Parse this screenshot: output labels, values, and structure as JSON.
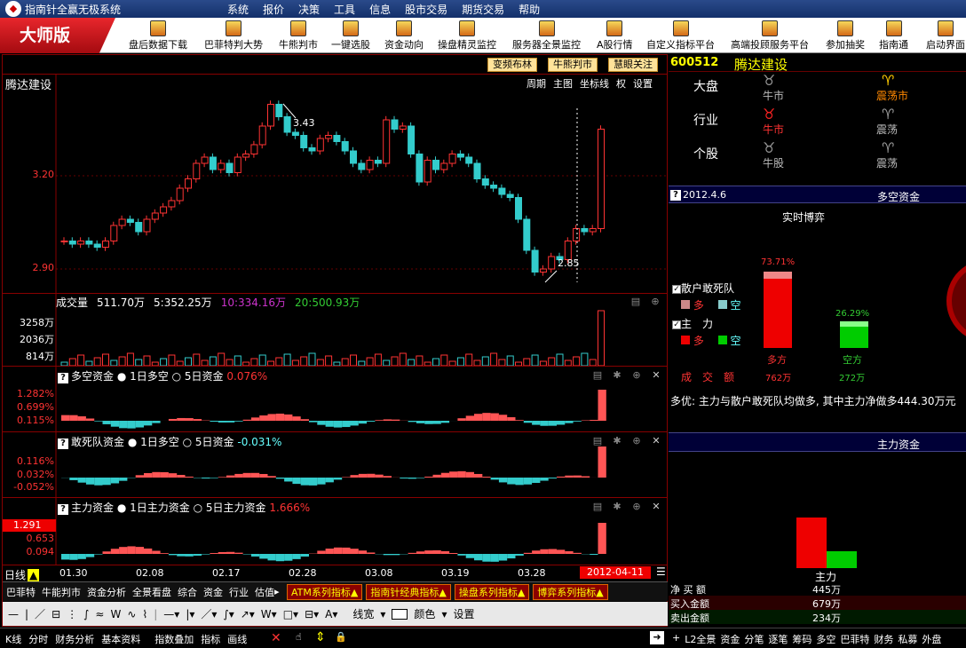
{
  "title_bar": {
    "app_title": "指南针全赢无极系统",
    "menu": [
      "系统",
      "报价",
      "决策",
      "工具",
      "信息",
      "股市交易",
      "期货交易",
      "帮助"
    ]
  },
  "toolbar": {
    "edition": "大师版",
    "buttons": [
      "盘后数据下载",
      "巴菲特判大势",
      "牛熊判市",
      "一键选股",
      "资金动向",
      "操盘精灵监控",
      "服务器全景监控",
      "A股行情",
      "自定义指标平台",
      "高端投顾服务平台",
      "参加抽奖",
      "指南通",
      "启动界面"
    ]
  },
  "chart_header": {
    "stock_name": "腾达建设",
    "buttons": [
      "变频布林",
      "牛熊判市",
      "慧眼关注"
    ],
    "links": [
      "周期",
      "主图",
      "坐标线",
      "权",
      "设置"
    ]
  },
  "price_chart": {
    "y_labels": [
      "3.20",
      "2.90"
    ],
    "high_label": "3.43",
    "low_label": "2.85"
  },
  "volume_panel": {
    "title": "成交量",
    "total": "511.70万",
    "ma5": "5:352.25万",
    "ma10": "10:334.16万",
    "ma20": "20:500.93万",
    "y_labels": [
      "3258万",
      "2036万",
      "814万"
    ]
  },
  "ind1": {
    "title": "多空资金",
    "opt1": "1日多空",
    "opt2": "5日资金",
    "value": "0.076%",
    "y_labels": [
      "1.282%",
      "0.699%",
      "0.115%"
    ]
  },
  "ind2": {
    "title": "敢死队资金",
    "opt1": "1日多空",
    "opt2": "5日资金",
    "value": "-0.031%",
    "y_labels": [
      "0.116%",
      "0.032%",
      "-0.052%"
    ]
  },
  "ind3": {
    "title": "主力资金",
    "opt1": "1日主力资金",
    "opt2": "5日主力资金",
    "value": "1.666%",
    "y_labels": [
      "1.291",
      "0.653",
      "0.094"
    ]
  },
  "time_axis": {
    "period": "日线",
    "dates": [
      "01.30",
      "02.08",
      "02.17",
      "02.28",
      "03.08",
      "03.19",
      "03.28"
    ],
    "cursor_date": "2012-04-11"
  },
  "bottom_tabs1": [
    "巴菲特",
    "牛能判市",
    "资金分析",
    "全景看盘",
    "综合",
    "资金",
    "行业",
    "估值"
  ],
  "bottom_tabs2": [
    "ATM系列指标",
    "指南针经典指标",
    "操盘系列指标",
    "博弈系列指标"
  ],
  "draw_tools": {
    "line_width": "线宽",
    "color": "颜色",
    "settings": "设置"
  },
  "status_bar": {
    "left": [
      "K线",
      "分时",
      "财务分析",
      "基本资料",
      "指数叠加",
      "指标",
      "画线"
    ],
    "right": [
      "L2全景",
      "资金",
      "分笔",
      "逐笔",
      "筹码",
      "多空",
      "巴菲特",
      "财务",
      "私募",
      "外盘"
    ]
  },
  "right_panel": {
    "code": "600512",
    "name": "腾达建设",
    "market_rows": [
      {
        "label": "大盘",
        "left": "牛市",
        "right": "震荡市"
      },
      {
        "label": "行业",
        "left": "牛市",
        "right": "震荡"
      },
      {
        "label": "个股",
        "left": "牛股",
        "right": "震荡"
      }
    ],
    "date": "2012.4.6",
    "section1_title": "多空资金",
    "realtime": "实时博弈",
    "legend1": "散户敢死队",
    "legend2": "主　力",
    "duo": "多",
    "kong": "空",
    "chengjiao": "成　交　额",
    "bar_duo_pct": "73.71%",
    "bar_kong_pct": "26.29%",
    "bar_duo_label": "多方",
    "bar_kong_label": "空方",
    "duo_amount": "762万",
    "kong_amount": "272万",
    "comment": "多优: 主力与散户敢死队均做多, 其中主力净做多444.30万元",
    "section2_title": "主力资金",
    "main_label": "主力",
    "rows": [
      {
        "label": "净 买 额",
        "value": "445万"
      },
      {
        "label": "买入金额",
        "value": "679万"
      },
      {
        "label": "卖出金额",
        "value": "234万"
      }
    ]
  }
}
